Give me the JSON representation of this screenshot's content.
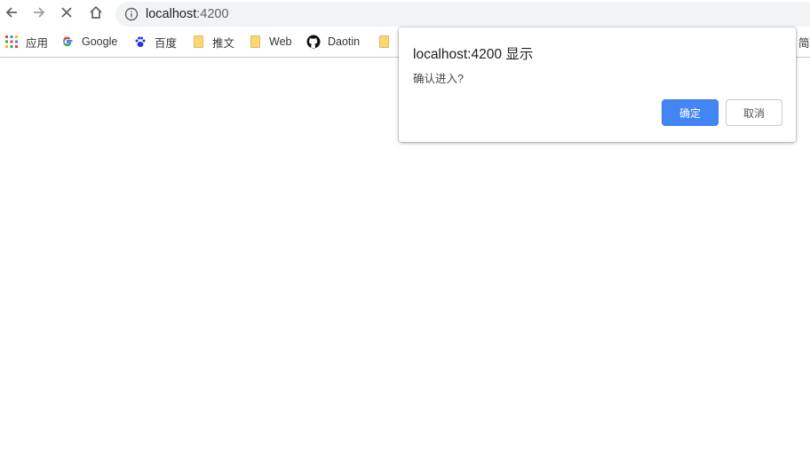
{
  "browser": {
    "url_host": "localhost",
    "url_port": ":4200",
    "icons": [
      "back-arrow-icon",
      "forward-arrow-icon",
      "stop-loading-icon",
      "home-icon",
      "info-icon"
    ]
  },
  "bookmarks": {
    "items": [
      {
        "label": "应用",
        "icon": "apps-grid-icon"
      },
      {
        "label": "Google",
        "icon": "google-icon"
      },
      {
        "label": "百度",
        "icon": "baidu-paw-icon"
      },
      {
        "label": "推文",
        "icon": "folder-icon"
      },
      {
        "label": "Web",
        "icon": "folder-icon"
      },
      {
        "label": "Daotin",
        "icon": "github-icon"
      }
    ],
    "overflow_char": "简"
  },
  "dialog": {
    "title": "localhost:4200 显示",
    "message": "确认进入?",
    "ok_label": "确定",
    "cancel_label": "取消"
  },
  "colors": {
    "accent": "#4285f4",
    "omnibox_bg": "#f1f3f4",
    "folder": "#f8d775"
  }
}
